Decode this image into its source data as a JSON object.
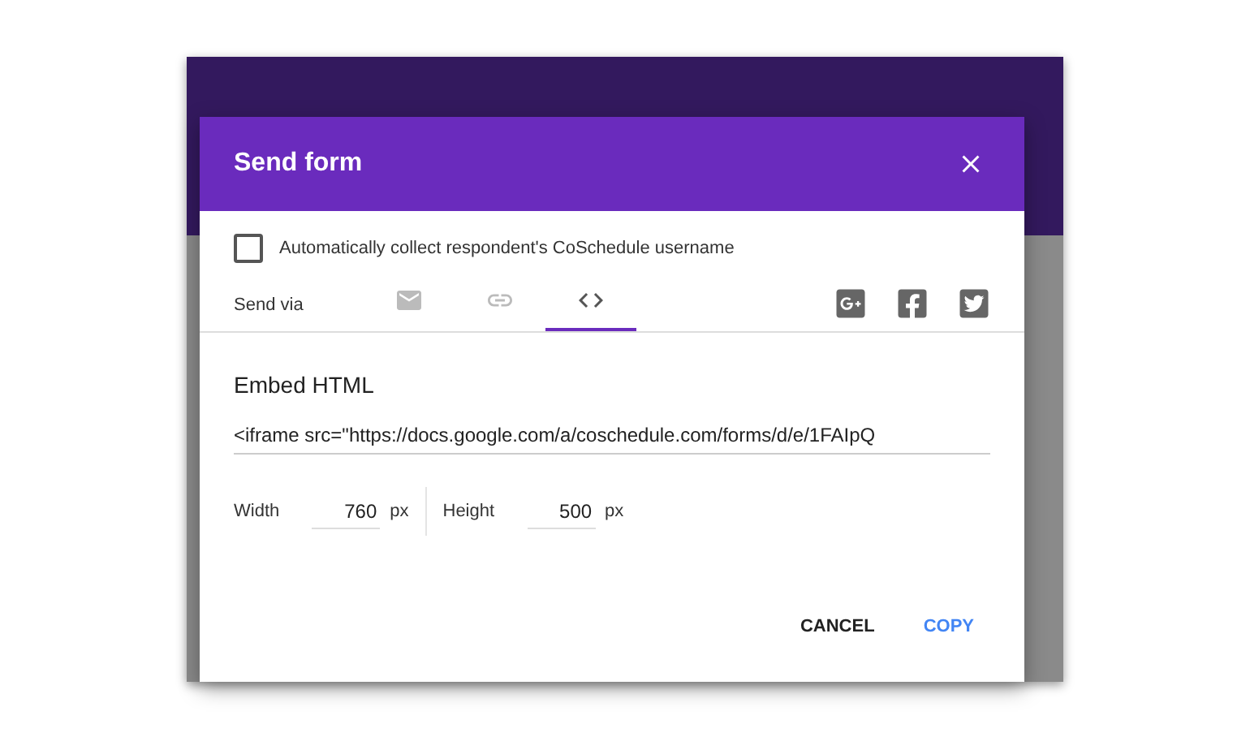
{
  "dialog": {
    "title": "Send form"
  },
  "collect": {
    "label": "Automatically collect respondent's CoSchedule username",
    "checked": false
  },
  "send_via": {
    "label": "Send via",
    "tabs": [
      {
        "kind": "email",
        "selected": false
      },
      {
        "kind": "link",
        "selected": false
      },
      {
        "kind": "embed",
        "selected": true
      }
    ],
    "social": [
      {
        "kind": "googleplus"
      },
      {
        "kind": "facebook"
      },
      {
        "kind": "twitter"
      }
    ]
  },
  "embed": {
    "title": "Embed HTML",
    "code": "<iframe src=\"https://docs.google.com/a/coschedule.com/forms/d/e/1FAIpQ",
    "width": {
      "label": "Width",
      "value": "760",
      "unit": "px"
    },
    "height": {
      "label": "Height",
      "value": "500",
      "unit": "px"
    }
  },
  "buttons": [
    {
      "label": "CANCEL",
      "kind": "secondary"
    },
    {
      "label": "COPY",
      "kind": "primary"
    }
  ]
}
